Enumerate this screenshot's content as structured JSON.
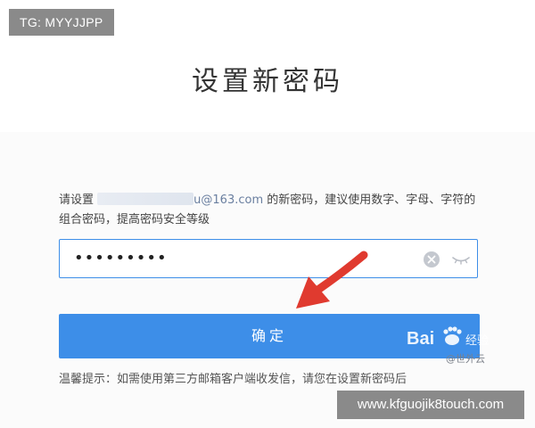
{
  "overlay": {
    "tg_label": "TG: MYYJJPP",
    "site_label": "www.kfguojik8touch.com"
  },
  "page": {
    "title": "设置新密码"
  },
  "form": {
    "instruction_prefix": "请设置",
    "email_domain": "u@163.com",
    "instruction_suffix": " 的新密码，建议使用数字、字母、字符的组合密码，提高密码安全等级",
    "password_value": "•••••••••",
    "confirm_label": "确定",
    "tip": "温馨提示：如需使用第三方邮箱客户端收发信，请您在设置新密码后"
  },
  "watermark": {
    "logo_text": "Bai",
    "logo_suffix": "经验",
    "sub_text": "@世外云"
  },
  "colors": {
    "primary": "#3d8ee8",
    "overlay_bg": "#8a8a8a",
    "arrow": "#e03a2f"
  },
  "icons": {
    "clear": "clear-icon",
    "eye": "eye-closed-icon",
    "arrow": "red-arrow-icon"
  }
}
